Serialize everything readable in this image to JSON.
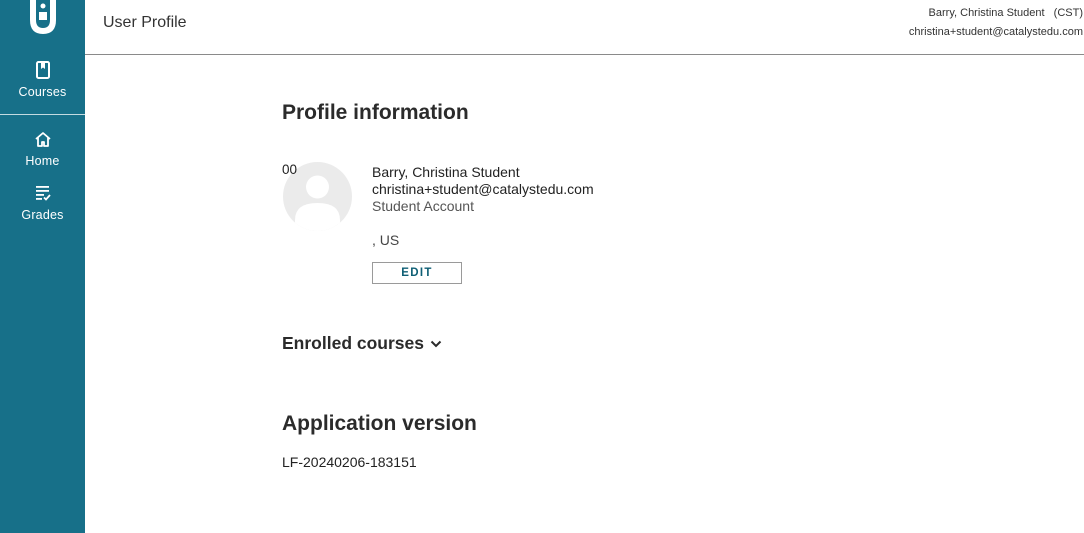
{
  "sidebar": {
    "items": [
      {
        "label": "Courses",
        "icon": "book-icon"
      },
      {
        "label": "Home",
        "icon": "home-icon"
      },
      {
        "label": "Grades",
        "icon": "grades-icon"
      }
    ]
  },
  "header": {
    "title": "User Profile",
    "user_name": "Barry, Christina Student   (CST)",
    "user_email": "christina+student@catalystedu.com"
  },
  "profile": {
    "section_title": "Profile information",
    "avatar_text": "00",
    "name": "Barry, Christina Student",
    "email": "christina+student@catalystedu.com",
    "account_type": "Student Account",
    "location": ", US",
    "edit_label": "EDIT"
  },
  "enrolled": {
    "title": "Enrolled courses"
  },
  "app_version": {
    "title": "Application version",
    "value": "LF-20240206-183151"
  },
  "colors": {
    "sidebar": "#177089",
    "accent": "#0f5f75"
  }
}
